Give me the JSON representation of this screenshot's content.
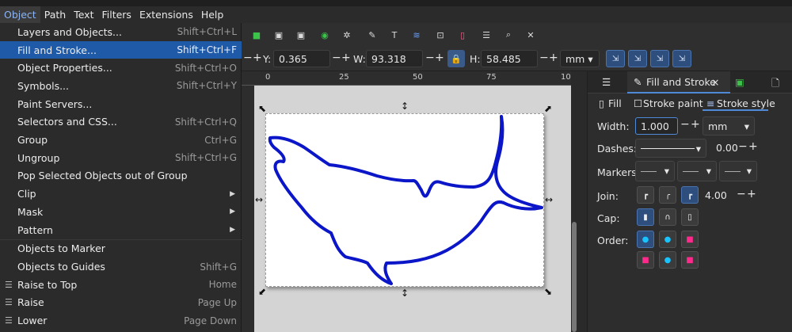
{
  "menubar": {
    "items": [
      "Object",
      "Path",
      "Text",
      "Filters",
      "Extensions",
      "Help"
    ],
    "active": "Object"
  },
  "object_menu": {
    "items": [
      {
        "label": "Layers and Objects...",
        "shortcut": "Shift+Ctrl+L"
      },
      {
        "label": "Fill and Stroke...",
        "shortcut": "Shift+Ctrl+F",
        "highlighted": true
      },
      {
        "label": "Object Properties...",
        "shortcut": "Shift+Ctrl+O"
      },
      {
        "label": "Symbols...",
        "shortcut": "Shift+Ctrl+Y"
      },
      {
        "label": "Paint Servers...",
        "shortcut": ""
      },
      {
        "label": "Selectors and CSS...",
        "shortcut": "Shift+Ctrl+Q"
      },
      {
        "label": "Group",
        "shortcut": "Ctrl+G"
      },
      {
        "label": "Ungroup",
        "shortcut": "Shift+Ctrl+G"
      },
      {
        "label": "Pop Selected Objects out of Group",
        "shortcut": ""
      },
      {
        "label": "Clip",
        "submenu": true
      },
      {
        "label": "Mask",
        "submenu": true
      },
      {
        "label": "Pattern",
        "submenu": true
      },
      {
        "label": "Objects to Marker",
        "shortcut": ""
      },
      {
        "label": "Objects to Guides",
        "shortcut": "Shift+G"
      },
      {
        "label": "Raise to Top",
        "shortcut": "Home",
        "icon": "raise-to-top-icon"
      },
      {
        "label": "Raise",
        "shortcut": "Page Up",
        "icon": "raise-icon"
      },
      {
        "label": "Lower",
        "shortcut": "Page Down",
        "icon": "lower-icon"
      }
    ]
  },
  "tool_controls": {
    "y_label": "Y:",
    "y_value": "0.365",
    "w_label": "W:",
    "w_value": "93.318",
    "h_label": "H:",
    "h_value": "58.485",
    "unit": "mm"
  },
  "ruler": {
    "ticks": [
      "0",
      "25",
      "50",
      "75",
      "10"
    ]
  },
  "panel": {
    "tab_label": "Fill and Stroke",
    "close_symbol": "×",
    "subtabs": {
      "fill": "Fill",
      "stroke_paint": "Stroke paint",
      "stroke_style": "Stroke style"
    },
    "width_label": "Width:",
    "width_value": "1.000",
    "width_unit": "mm",
    "dashes_label": "Dashes:",
    "dashes_value": "0.00",
    "markers_label": "Markers:",
    "join_label": "Join:",
    "join_value": "4.00",
    "cap_label": "Cap:",
    "order_label": "Order:"
  },
  "symbols": {
    "minus": "−",
    "plus": "+",
    "dropdown": "▾",
    "submenu_arrow": "▶"
  },
  "colors": {
    "accent": "#4f8ad8",
    "menu_highlight": "#1e5aa8",
    "shark_stroke": "#0a16c8"
  }
}
